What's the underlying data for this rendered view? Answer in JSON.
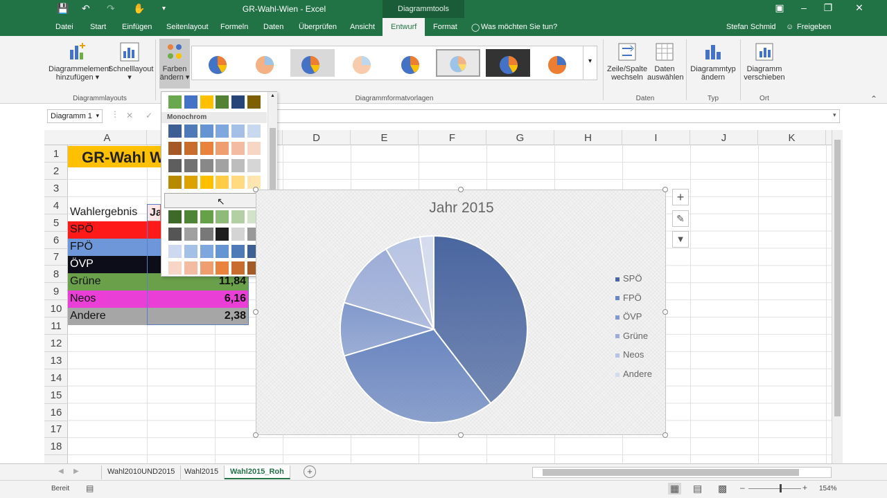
{
  "title_bar": {
    "document_title": "GR-Wahl-Wien - Excel",
    "context_tools_title": "Diagrammtools"
  },
  "ribbon_tabs": [
    "Datei",
    "Start",
    "Einfügen",
    "Seitenlayout",
    "Formeln",
    "Daten",
    "Überprüfen",
    "Ansicht",
    "Entwurf",
    "Format"
  ],
  "tell_me": "Was möchten Sie tun?",
  "user": "Stefan Schmid",
  "share": "Freigeben",
  "ribbon": {
    "add_element": [
      "Diagrammelement",
      "hinzufügen"
    ],
    "quick_layout": "Schnelllayout",
    "change_colors": [
      "Farben",
      "ändern"
    ],
    "group_layouts": "Diagrammlayouts",
    "group_styles": "Diagrammformatvorlagen",
    "switch_row_col": [
      "Zeile/Spalte",
      "wechseln"
    ],
    "select_data": [
      "Daten",
      "auswählen"
    ],
    "group_data": "Daten",
    "change_type": [
      "Diagrammtyp",
      "ändern"
    ],
    "group_type": "Typ",
    "move_chart": [
      "Diagramm",
      "verschieben"
    ],
    "group_location": "Ort"
  },
  "name_box": "Diagramm 1",
  "columns": [
    "A",
    "B",
    "C",
    "D",
    "E",
    "F",
    "G",
    "H",
    "I",
    "J",
    "K"
  ],
  "rows": [
    "1",
    "2",
    "3",
    "4",
    "5",
    "6",
    "7",
    "8",
    "9",
    "10",
    "11",
    "12",
    "13",
    "14",
    "15",
    "16",
    "17",
    "18"
  ],
  "sheet": {
    "a1_title": "GR-Wahl W",
    "a4_header": "Wahlergebnis",
    "b4_header": "Ja",
    "parties": [
      {
        "name": "SPÖ",
        "value": "",
        "color": "#ff1a1a"
      },
      {
        "name": "FPÖ",
        "value": "",
        "color": "#6d97d8"
      },
      {
        "name": "ÖVP",
        "value": "",
        "color": "#0d0d1a"
      },
      {
        "name": "Grüne",
        "value": "11,84",
        "color": "#6aa04a"
      },
      {
        "name": "Neos",
        "value": "6,16",
        "color": "#ea3fd6"
      },
      {
        "name": "Andere",
        "value": "2,38",
        "color": "#a6a6a6"
      }
    ]
  },
  "color_panel": {
    "section_label": "Monochrom",
    "rows": [
      [
        "#6aa84f",
        "#4472c4",
        "#ffc000",
        "#548235",
        "#264478",
        "#7f6000"
      ],
      [
        "#3d5f94",
        "#4e7ab7",
        "#6495d2",
        "#7ea8dd",
        "#a4c0e6",
        "#c7d8ef"
      ],
      [
        "#a35a26",
        "#c96d2e",
        "#e9823c",
        "#ef9f6f",
        "#f3bca2",
        "#f7d6c6"
      ],
      [
        "#5e5e5e",
        "#727272",
        "#888888",
        "#a2a2a2",
        "#bdbdbd",
        "#d6d6d6"
      ],
      [
        "#b88a00",
        "#dca200",
        "#ffc000",
        "#ffcd45",
        "#ffda80",
        "#ffe6b1"
      ],
      [
        "#2e4472",
        "#3d5996",
        "#4d6cb4",
        "#8597cd",
        "#aab6db",
        "#ccd3e8"
      ],
      [
        "#3d6a2a",
        "#4d8435",
        "#66a047",
        "#8fbb7a",
        "#b3d0a5",
        "#d2e3ca"
      ],
      [
        "#555555",
        "#a0a0a0",
        "#787878",
        "#1e1e1e",
        "#d4d4d4",
        "#999999"
      ],
      [
        "#cdd9ee",
        "#a4c0e6",
        "#7ea8dd",
        "#6495d2",
        "#4e7ab7",
        "#3d5f94"
      ],
      [
        "#f7d6c6",
        "#f3bca2",
        "#ef9f6f",
        "#e9823c",
        "#c96d2e",
        "#a35a26"
      ]
    ]
  },
  "chart_data": {
    "type": "pie",
    "title": "Jahr 2015",
    "categories": [
      "SPÖ",
      "FPÖ",
      "ÖVP",
      "Grüne",
      "Neos",
      "Andere"
    ],
    "values": [
      39.59,
      30.79,
      9.24,
      11.84,
      6.16,
      2.38
    ],
    "colors": [
      "#4a66a0",
      "#6a86c0",
      "#8199cc",
      "#9bacd7",
      "#b7c3e3",
      "#d3dbee"
    ],
    "legend_position": "right"
  },
  "sheet_tabs": [
    "Wahl2010UND2015",
    "Wahl2015",
    "Wahl2015_Roh"
  ],
  "status": "Bereit",
  "zoom": "154%"
}
